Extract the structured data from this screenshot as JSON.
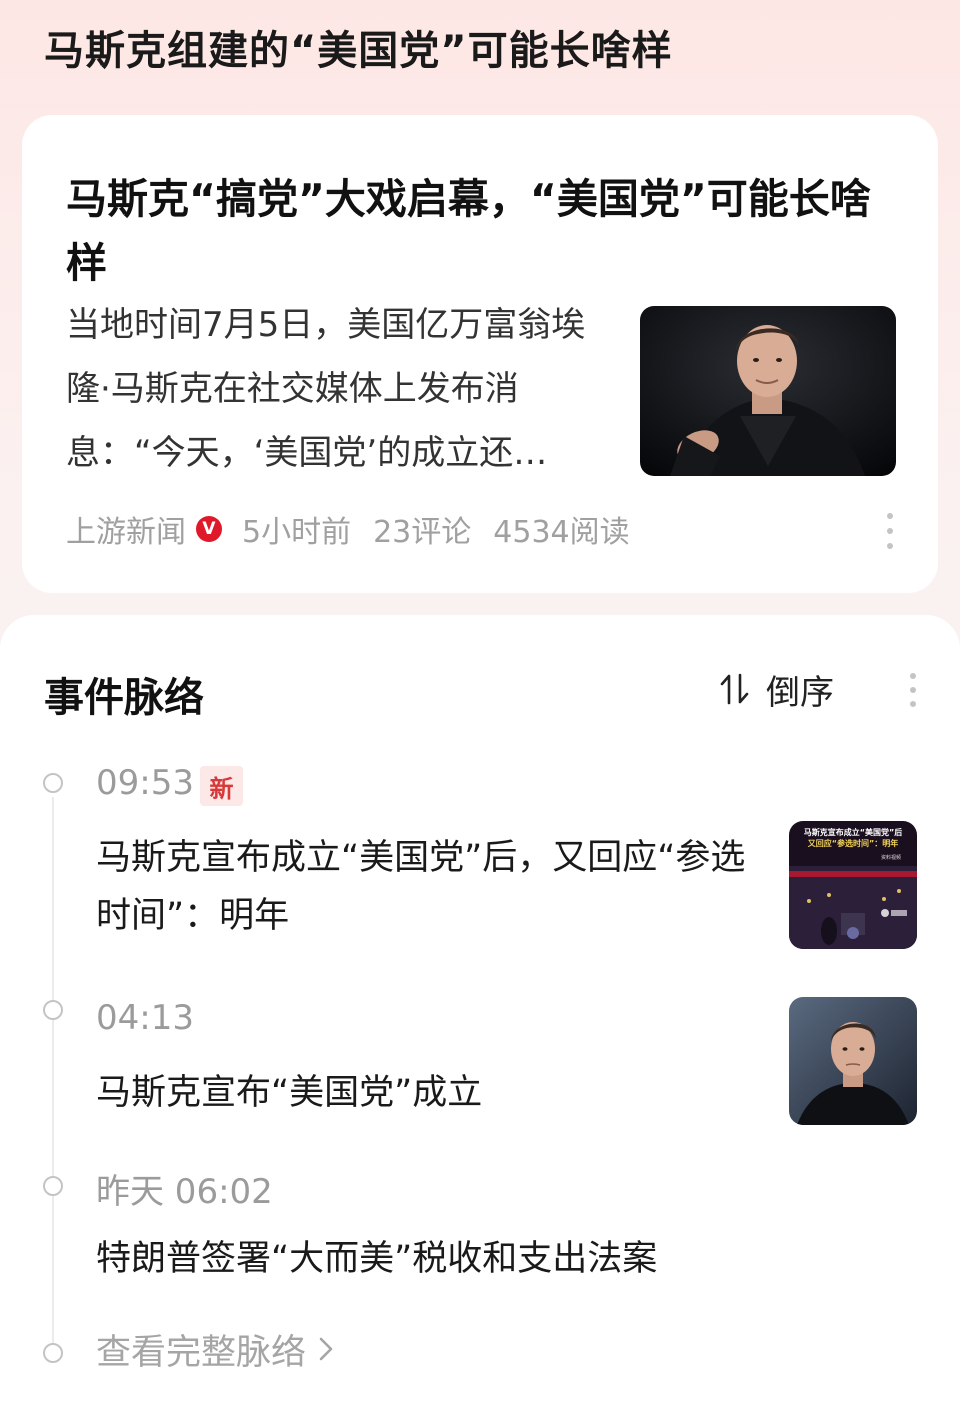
{
  "header": {
    "title": "马斯克组建的“美国党”可能长啥样"
  },
  "article": {
    "title": "马斯克“搞党”大戏启幕，“美国党”可能长啥样",
    "summary": "当地时间7月5日，美国亿万富翁埃隆·马斯克在社交媒体上发布消息：“今天，‘美国党’的成立还…",
    "source": "上游新闻",
    "verified_mark": "V",
    "time": "5小时前",
    "comments": "23评论",
    "reads": "4534阅读",
    "thumbnail_icon": "portrait-photo"
  },
  "timeline": {
    "title": "事件脉络",
    "sort_label": "倒序",
    "sort_icon": "sort-arrows-icon",
    "new_badge": "新",
    "items": [
      {
        "time": "09:53",
        "text": "马斯克宣布成立“美国党”后，又回应“参选时间”：明年",
        "thumb_caption_1": "马斯克宣布成立“美国党”后",
        "thumb_caption_2": "又回应“参选时间”：明年",
        "thumb_label": "资料视频"
      },
      {
        "time": "04:13",
        "text": "马斯克宣布“美国党”成立"
      },
      {
        "time": "昨天 06:02",
        "text": "特朗普签署“大而美”税收和支出法案"
      }
    ],
    "view_all": "查看完整脉络"
  }
}
